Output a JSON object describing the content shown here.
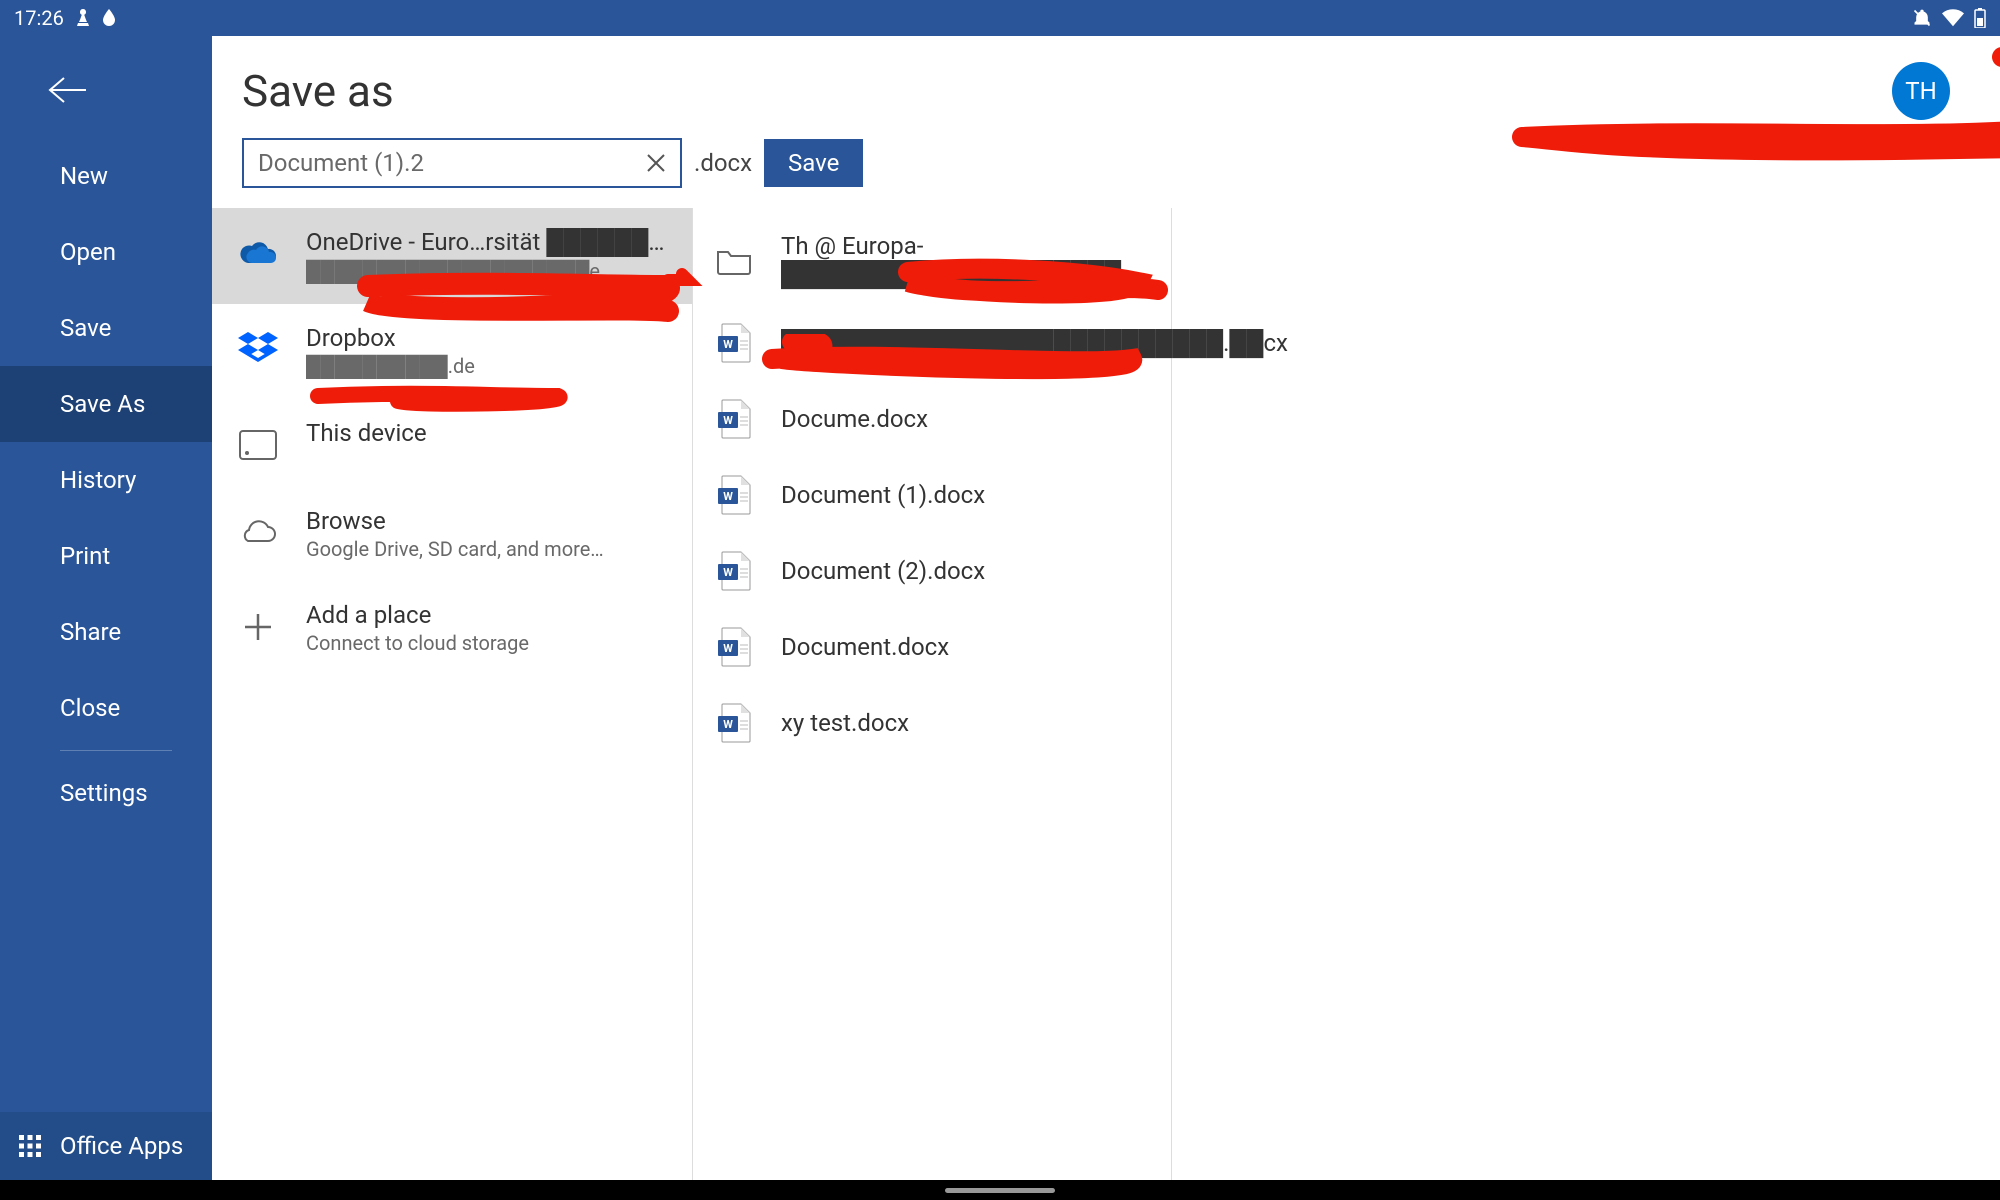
{
  "statusbar": {
    "time": "17:26"
  },
  "sidebar": {
    "items": [
      {
        "label": "New",
        "selected": false
      },
      {
        "label": "Open",
        "selected": false
      },
      {
        "label": "Save",
        "selected": false
      },
      {
        "label": "Save As",
        "selected": true
      },
      {
        "label": "History",
        "selected": false
      },
      {
        "label": "Print",
        "selected": false
      },
      {
        "label": "Share",
        "selected": false
      },
      {
        "label": "Close",
        "selected": false
      },
      {
        "label": "Settings",
        "selected": false
      }
    ],
    "footer_label": "Office Apps"
  },
  "header": {
    "title": "Save as",
    "avatar_initials": "TH"
  },
  "filename": {
    "value": "Document (1).2",
    "extension": ".docx",
    "save_label": "Save"
  },
  "locations": [
    {
      "icon": "onedrive",
      "title": "OneDrive - Euro…rsität ████████g",
      "sub": "████████████████████e",
      "selected": true
    },
    {
      "icon": "dropbox",
      "title": "Dropbox",
      "sub": "██████████.de",
      "selected": false
    },
    {
      "icon": "device",
      "title": "This device",
      "sub": "",
      "selected": false
    },
    {
      "icon": "cloud",
      "title": "Browse",
      "sub": "Google Drive, SD card, and more…",
      "selected": false
    },
    {
      "icon": "plus",
      "title": "Add a place",
      "sub": "Connect to cloud storage",
      "selected": false
    }
  ],
  "files": [
    {
      "icon": "folder",
      "name": "Th @ Europa-████████████████████"
    },
    {
      "icon": "word",
      "name": "██████████████████████████.██cx"
    },
    {
      "icon": "word",
      "name": "Docume.docx"
    },
    {
      "icon": "word",
      "name": "Document (1).docx"
    },
    {
      "icon": "word",
      "name": "Document (2).docx"
    },
    {
      "icon": "word",
      "name": "Document.docx"
    },
    {
      "icon": "word",
      "name": "xy test.docx"
    }
  ]
}
